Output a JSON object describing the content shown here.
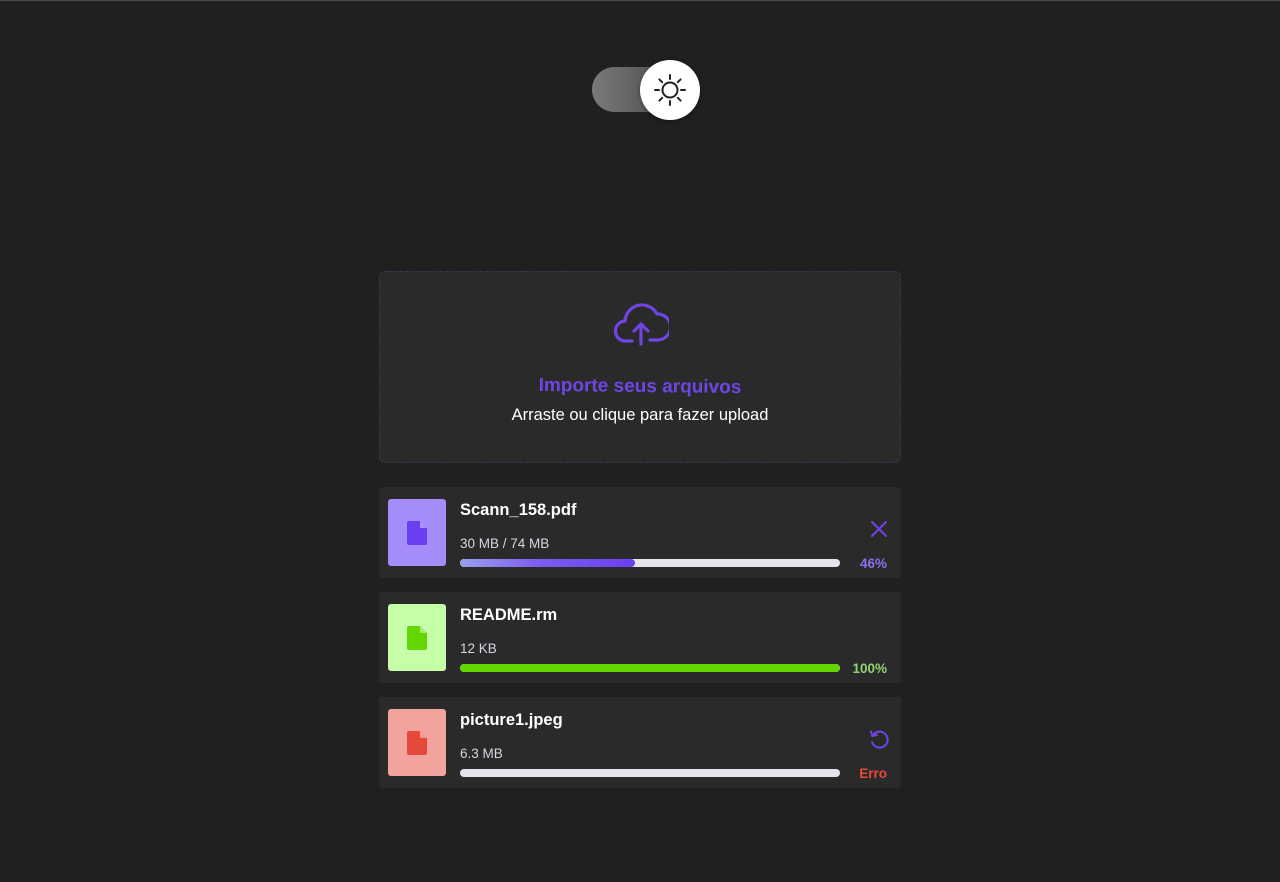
{
  "theme_toggle": {
    "icon": "sun-icon",
    "state": "light"
  },
  "dropzone": {
    "icon": "cloud-upload-icon",
    "title": "Importe seus arquivos",
    "subtitle": "Arraste ou clique para fazer upload",
    "accent": "#6f45e6"
  },
  "files": [
    {
      "name": "Scann_158.pdf",
      "size": "30 MB / 74 MB",
      "progress": 0.46,
      "status_text": "46%",
      "status_color": "#8b6ff0",
      "thumb_bg": "#a48cfb",
      "icon_color": "#6a3ff0",
      "bar_fill": "linear-gradient(90deg, #9aa0ea 0%, #7d5cf0 45%, #6a3ff0 100%)",
      "action": "close-icon"
    },
    {
      "name": "README.rm",
      "size": "12 KB",
      "progress": 1.0,
      "status_text": "100%",
      "status_color": "#8fd473",
      "thumb_bg": "#c6fda9",
      "icon_color": "#62d800",
      "bar_fill": "#62d800",
      "action": ""
    },
    {
      "name": "picture1.jpeg",
      "size": "6.3 MB",
      "progress": 0.0,
      "status_text": "Erro",
      "status_color": "#e5493a",
      "thumb_bg": "#f2a39d",
      "icon_color": "#e5493a",
      "bar_fill": "#e5493a",
      "action": "retry-icon"
    }
  ]
}
